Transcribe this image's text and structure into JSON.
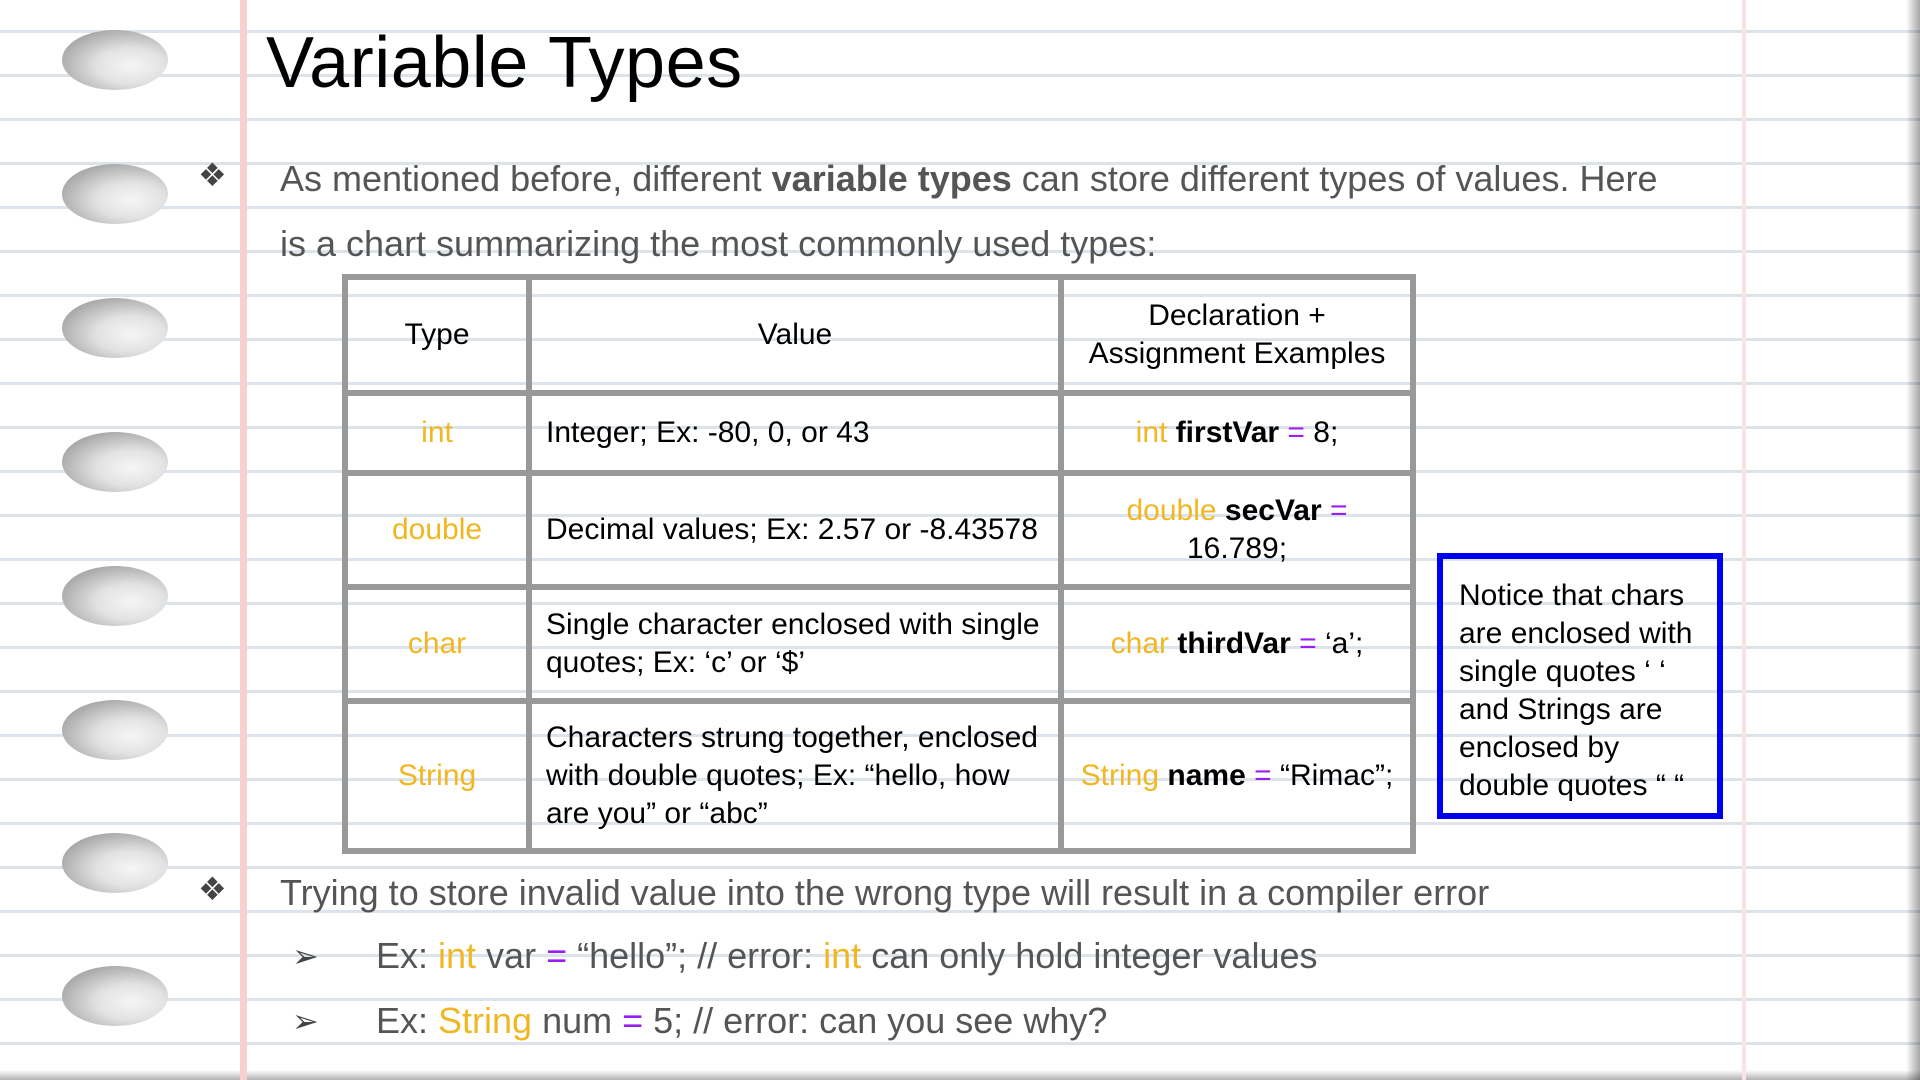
{
  "slide": {
    "title": "Variable Types",
    "intro": {
      "part1": "As mentioned before, different ",
      "bold": "variable types",
      "part2": " can store different types of values. Here",
      "line2": "is a chart summarizing the most commonly used types:"
    },
    "table": {
      "headers": [
        "Type",
        "Value",
        "Declaration + Assignment Examples"
      ],
      "rows": [
        {
          "type": "int",
          "value": "Integer; Ex: -80, 0, or 43",
          "ex_type": "int",
          "ex_name": "firstVar",
          "ex_eq": "=",
          "ex_val": "8;"
        },
        {
          "type": "double",
          "value": "Decimal values; Ex: 2.57 or -8.43578",
          "ex_type": "double",
          "ex_name": "secVar",
          "ex_eq": "=",
          "ex_val": "16.789;"
        },
        {
          "type": "char",
          "value": "Single character enclosed with single quotes; Ex: ‘c’ or ‘$’",
          "ex_type": "char",
          "ex_name": "thirdVar",
          "ex_eq": "=",
          "ex_val": "‘a’;"
        },
        {
          "type": "String",
          "value": "Characters strung together, enclosed with double quotes; Ex: “hello, how are you” or “abc”",
          "ex_type": "String",
          "ex_name": "name",
          "ex_eq": "=",
          "ex_val": "“Rimac”;"
        }
      ]
    },
    "note": "Notice that chars are enclosed with single quotes ‘ ‘ and Strings are enclosed by double quotes “ “",
    "bullet2": "Trying to store invalid value into the wrong type will result in a compiler error",
    "example1": {
      "prefix": "Ex: ",
      "kw": "int",
      "mid": " var ",
      "eq": "=",
      "rest": " “hello”; // error: ",
      "kw2": "int",
      "tail": " can only hold integer values"
    },
    "example2": {
      "prefix": "Ex: ",
      "kw": "String",
      "mid": " num ",
      "eq": "=",
      "rest": " 5; // error: can you see why?"
    },
    "bullet_glyph": "❖",
    "arrow_glyph": "➢"
  },
  "colors": {
    "keyword": "#f1b722",
    "operator": "#9b1df2",
    "note_border": "#0000f0",
    "table_border": "#999999"
  },
  "icons": {
    "bullet": "diamond-bullet-icon",
    "arrow": "arrow-bullet-icon",
    "holes": "binder-hole"
  }
}
